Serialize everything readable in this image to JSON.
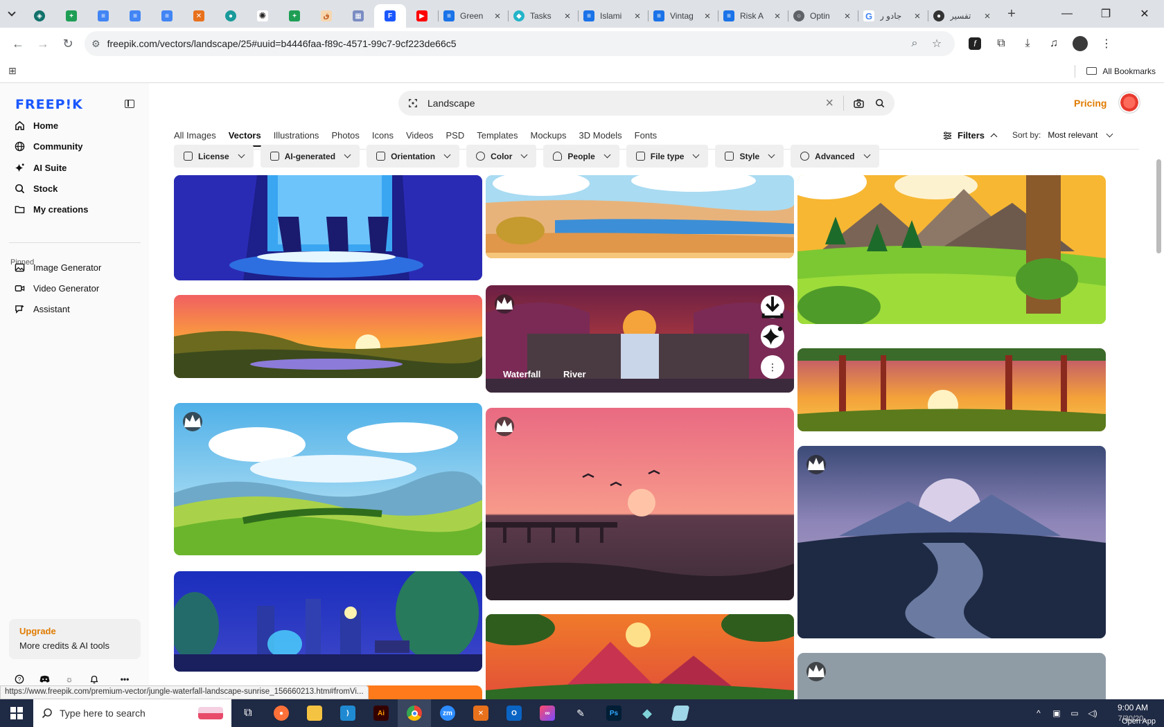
{
  "browser": {
    "tabs": [
      {
        "title": "Green",
        "color": "#1a73e8"
      },
      {
        "title": "Tasks",
        "color": "#23b4c9"
      },
      {
        "title": "Islami",
        "color": "#1a73e8"
      },
      {
        "title": "Vintag",
        "color": "#1a73e8"
      },
      {
        "title": "Risk A",
        "color": "#1a73e8"
      },
      {
        "title": "Optin",
        "color": "#5f6368"
      },
      {
        "title": "جادو ر",
        "color": "#4285f4"
      },
      {
        "title": "تفسير",
        "color": "#333333"
      }
    ],
    "url": "freepik.com/vectors/landscape/25#uuid=b4446faa-f89c-4571-99c7-9cf223de66c5",
    "bookmarks_label": "All Bookmarks",
    "status_url": "https://www.freepik.com/premium-vector/jungle-waterfall-landscape-sunrise_156660213.htm#fromVi..."
  },
  "sidebar": {
    "logo": "FREEP!K",
    "nav": [
      {
        "label": "Home",
        "icon": "home-icon"
      },
      {
        "label": "Community",
        "icon": "globe-icon"
      },
      {
        "label": "AI Suite",
        "icon": "sparkle-icon"
      },
      {
        "label": "Stock",
        "icon": "search-icon"
      },
      {
        "label": "My creations",
        "icon": "folder-icon"
      }
    ],
    "pinned_label": "Pinned",
    "pinned": [
      {
        "label": "Image Generator",
        "icon": "image-icon"
      },
      {
        "label": "Video Generator",
        "icon": "video-icon"
      },
      {
        "label": "Assistant",
        "icon": "chat-icon"
      }
    ],
    "upgrade_title": "Upgrade",
    "upgrade_sub": "More credits & AI tools"
  },
  "header": {
    "search_value": "Landscape",
    "pricing": "Pricing"
  },
  "categories": [
    "All Images",
    "Vectors",
    "Illustrations",
    "Photos",
    "Icons",
    "Videos",
    "PSD",
    "Templates",
    "Mockups",
    "3D Models",
    "Fonts"
  ],
  "active_category": "Vectors",
  "filters_label": "Filters",
  "sort_label": "Sort by:",
  "sort_value": "Most relevant",
  "chips": [
    "License",
    "AI-generated",
    "Orientation",
    "Color",
    "People",
    "File type",
    "Style",
    "Advanced"
  ],
  "hover_tags": [
    "Waterfall",
    "River"
  ],
  "taskbar": {
    "search_placeholder": "Type here to search",
    "time": "9:00 AM",
    "date": "7/30/20..",
    "open_app": "Open App"
  },
  "colors": {
    "brand": "#1a57ff",
    "accent": "#e07b00"
  }
}
